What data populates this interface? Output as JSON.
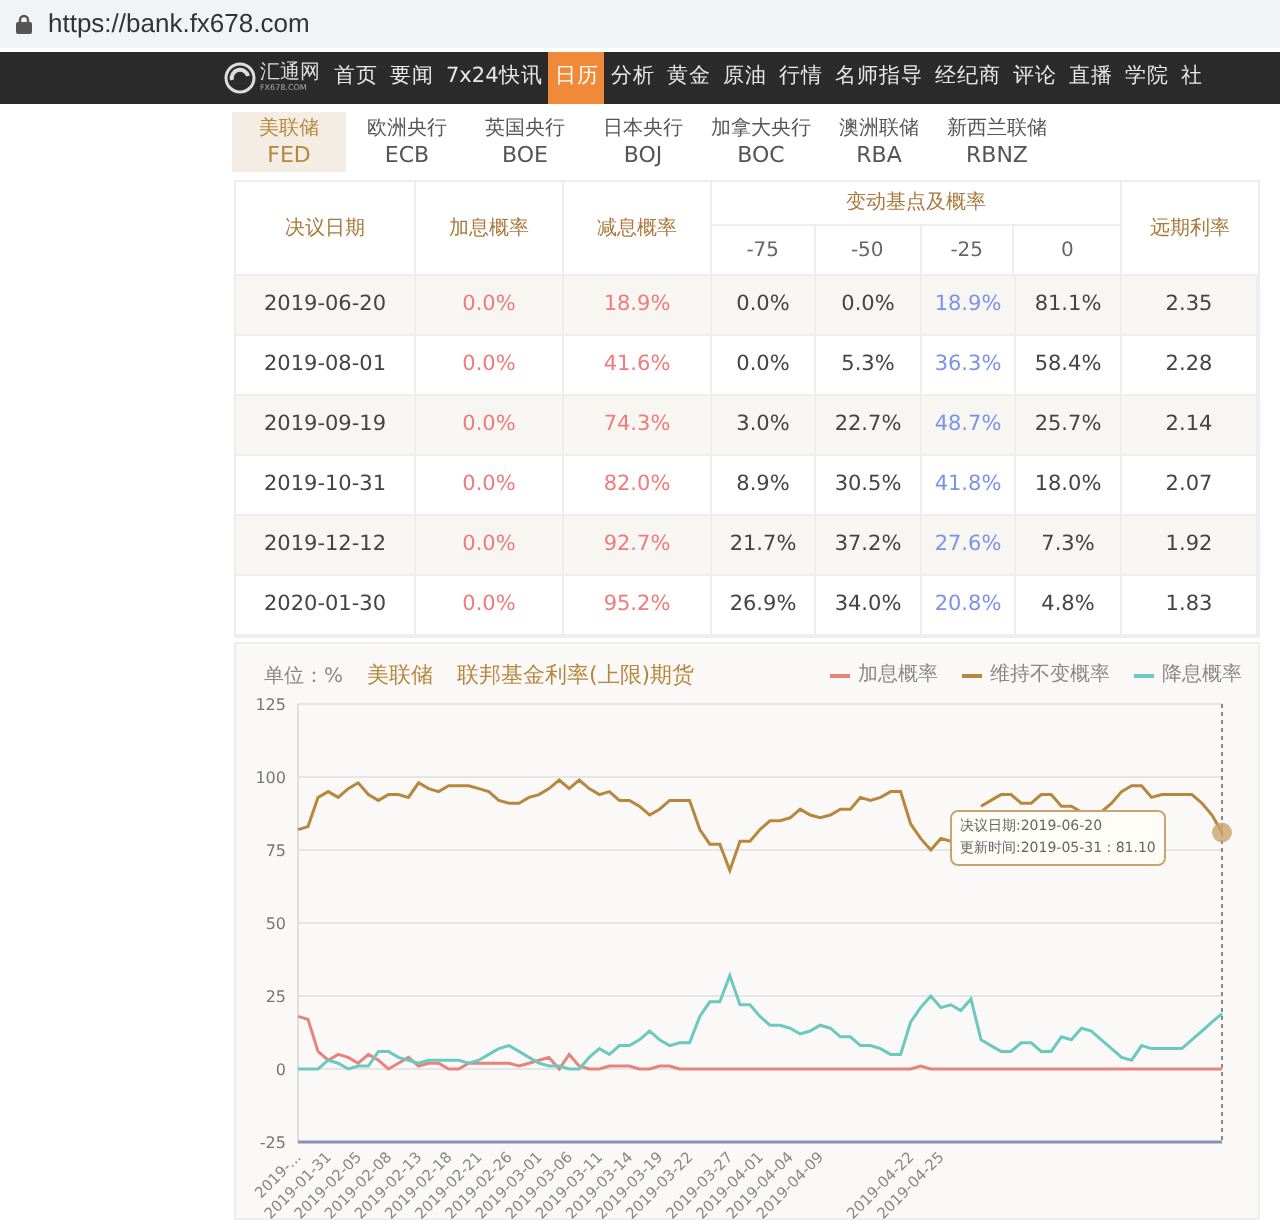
{
  "browser": {
    "url": "https://bank.fx678.com"
  },
  "nav": {
    "logo": {
      "name": "汇通网",
      "domain": "FX678.COM"
    },
    "items": [
      {
        "label": "首页",
        "selected": false
      },
      {
        "label": "要闻",
        "selected": false
      },
      {
        "label": "7x24快讯",
        "selected": false
      },
      {
        "label": "日历",
        "selected": true
      },
      {
        "label": "分析",
        "selected": false
      },
      {
        "label": "黄金",
        "selected": false
      },
      {
        "label": "原油",
        "selected": false
      },
      {
        "label": "行情",
        "selected": false
      },
      {
        "label": "名师指导",
        "selected": false
      },
      {
        "label": "经纪商",
        "selected": false
      },
      {
        "label": "评论",
        "selected": false
      },
      {
        "label": "直播",
        "selected": false
      },
      {
        "label": "学院",
        "selected": false
      },
      {
        "label": "社",
        "selected": false
      }
    ]
  },
  "bank_tabs": [
    {
      "name": "美联储",
      "code": "FED",
      "selected": true
    },
    {
      "name": "欧洲央行",
      "code": "ECB",
      "selected": false
    },
    {
      "name": "英国央行",
      "code": "BOE",
      "selected": false
    },
    {
      "name": "日本央行",
      "code": "BOJ",
      "selected": false
    },
    {
      "name": "加拿大央行",
      "code": "BOC",
      "selected": false
    },
    {
      "name": "澳洲联储",
      "code": "RBA",
      "selected": false
    },
    {
      "name": "新西兰联储",
      "code": "RBNZ",
      "selected": false
    }
  ],
  "table": {
    "group_header": "变动基点及概率",
    "columns": [
      {
        "label": "决议日期",
        "kind": "date"
      },
      {
        "label": "加息概率",
        "kind": "hike"
      },
      {
        "label": "减息概率",
        "kind": "cut"
      },
      {
        "label": "-75",
        "kind": "bp"
      },
      {
        "label": "-50",
        "kind": "bp"
      },
      {
        "label": "-25",
        "kind": "bp_highlight"
      },
      {
        "label": "0",
        "kind": "bp"
      },
      {
        "label": "远期利率",
        "kind": "rate"
      }
    ],
    "rows": [
      [
        "2019-06-20",
        "0.0%",
        "18.9%",
        "0.0%",
        "0.0%",
        "18.9%",
        "81.1%",
        "2.35"
      ],
      [
        "2019-08-01",
        "0.0%",
        "41.6%",
        "0.0%",
        "5.3%",
        "36.3%",
        "58.4%",
        "2.28"
      ],
      [
        "2019-09-19",
        "0.0%",
        "74.3%",
        "3.0%",
        "22.7%",
        "48.7%",
        "25.7%",
        "2.14"
      ],
      [
        "2019-10-31",
        "0.0%",
        "82.0%",
        "8.9%",
        "30.5%",
        "41.8%",
        "18.0%",
        "2.07"
      ],
      [
        "2019-12-12",
        "0.0%",
        "92.7%",
        "21.7%",
        "37.2%",
        "27.6%",
        "7.3%",
        "1.92"
      ],
      [
        "2020-01-30",
        "0.0%",
        "95.2%",
        "26.9%",
        "34.0%",
        "20.8%",
        "4.8%",
        "1.83"
      ]
    ]
  },
  "chart": {
    "unit_label": "单位：%",
    "bank_label": "美联储",
    "tooltip": [
      "决议日期:2019-06-20",
      "更新时间:2019-05-31 : 81.10"
    ],
    "chart_data": {
      "type": "line",
      "title": "联邦基金利率(上限)期货",
      "yticks": [
        -25,
        0,
        25,
        50,
        75,
        100,
        125
      ],
      "ylim": [
        -25,
        125
      ],
      "grid": true,
      "categories": [
        "2019-...",
        null,
        null,
        "2019-01-31",
        null,
        null,
        "2019-02-05",
        null,
        null,
        "2019-02-08",
        null,
        null,
        "2019-02-13",
        null,
        null,
        "2019-02-18",
        null,
        null,
        "2019-02-21",
        null,
        null,
        "2019-02-26",
        null,
        null,
        "2019-03-01",
        null,
        null,
        "2019-03-06",
        null,
        null,
        "2019-03-11",
        null,
        null,
        "2019-03-14",
        null,
        null,
        "2019-03-19",
        null,
        null,
        "2019-03-22",
        null,
        null,
        null,
        "2019-03-27",
        null,
        null,
        "2019-04-01",
        null,
        null,
        "2019-04-04",
        null,
        null,
        "2019-04-09",
        null,
        null,
        null,
        null,
        null,
        null,
        null,
        null,
        "2019-04-22",
        null,
        null,
        "2019-04-25",
        null,
        null,
        null,
        null,
        null,
        null,
        null,
        null,
        null,
        null,
        null,
        null,
        null,
        null,
        null,
        null,
        null,
        null,
        null,
        null,
        null,
        null,
        null,
        null,
        null,
        null,
        null,
        null
      ],
      "series": [
        {
          "name": "加息概率",
          "color": "#e8837c",
          "values": [
            18,
            17,
            6,
            3,
            5,
            4,
            2,
            5,
            3,
            0,
            2,
            4,
            1,
            2,
            2,
            0,
            0,
            2,
            2,
            2,
            2,
            2,
            1,
            2,
            3,
            4,
            0,
            5,
            1,
            0,
            0,
            1,
            1,
            1,
            0,
            0,
            1,
            1,
            0,
            0,
            0,
            0,
            0,
            0,
            0,
            0,
            0,
            0,
            0,
            0,
            0,
            0,
            0,
            0,
            0,
            0,
            0,
            0,
            0,
            0,
            0,
            0,
            1,
            0,
            0,
            0,
            0,
            0,
            0,
            0,
            0,
            0,
            0,
            0,
            0,
            0,
            0,
            0,
            0,
            0,
            0,
            0,
            0,
            0,
            0,
            0,
            0,
            0,
            0,
            0,
            0,
            0,
            0
          ]
        },
        {
          "name": "维持不变概率",
          "color": "#b8873e",
          "values": [
            82,
            83,
            93,
            95,
            93,
            96,
            98,
            94,
            92,
            94,
            94,
            93,
            98,
            96,
            95,
            97,
            97,
            97,
            96,
            95,
            92,
            91,
            91,
            93,
            94,
            96,
            99,
            96,
            99,
            96,
            94,
            95,
            92,
            92,
            90,
            87,
            89,
            92,
            92,
            92,
            82,
            77,
            77,
            68,
            78,
            78,
            82,
            85,
            85,
            86,
            89,
            87,
            86,
            87,
            89,
            89,
            93,
            92,
            93,
            95,
            95,
            84,
            79,
            75,
            79,
            78,
            null,
            null,
            90,
            92,
            94,
            94,
            91,
            91,
            94,
            94,
            90,
            90,
            88,
            88,
            88,
            91,
            95,
            97,
            97,
            93,
            94,
            94,
            94,
            94,
            91,
            87,
            81
          ]
        },
        {
          "name": "降息概率",
          "color": "#6cc9c0",
          "values": [
            0,
            0,
            0,
            3,
            2,
            0,
            1,
            1,
            6,
            6,
            4,
            3,
            2,
            3,
            3,
            3,
            3,
            2,
            3,
            5,
            7,
            8,
            6,
            4,
            2,
            1,
            1,
            0,
            0,
            4,
            7,
            5,
            8,
            8,
            10,
            13,
            10,
            8,
            9,
            9,
            18,
            23,
            23,
            32,
            22,
            22,
            18,
            15,
            15,
            14,
            12,
            13,
            15,
            14,
            11,
            11,
            8,
            8,
            7,
            5,
            5,
            16,
            21,
            25,
            21,
            22,
            20,
            24,
            10,
            8,
            6,
            6,
            9,
            9,
            6,
            6,
            11,
            10,
            14,
            13,
            10,
            7,
            4,
            3,
            8,
            7,
            7,
            7,
            7,
            10,
            13,
            16,
            19
          ]
        }
      ]
    }
  }
}
